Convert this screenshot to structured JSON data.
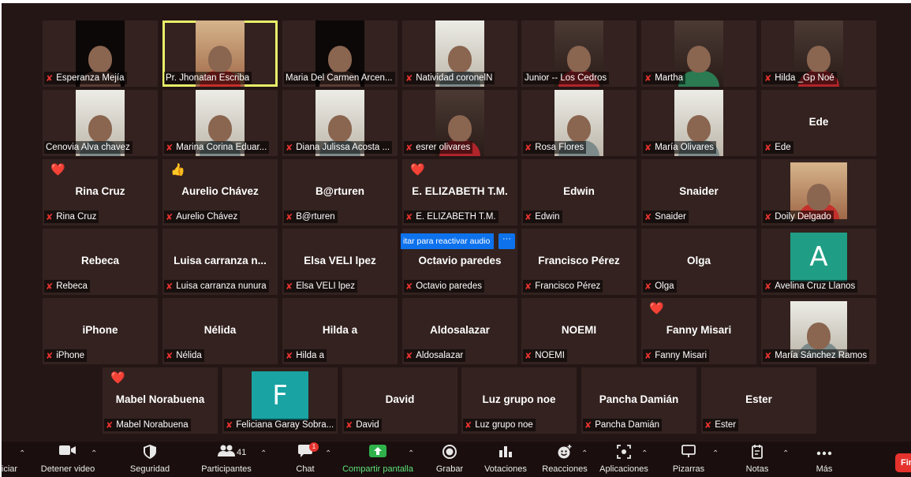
{
  "gallery": {
    "row1": [
      {
        "name": "Esperanza Mejía",
        "muted": true,
        "video": "dark"
      },
      {
        "name": "Pr. Jhonatan Escriba",
        "muted": false,
        "video": "warm",
        "active": true
      },
      {
        "name": "Maria Del Carmen Arcen...",
        "muted": false,
        "video": "dark"
      },
      {
        "name": "Natividad coronelN",
        "muted": true,
        "video": "light"
      },
      {
        "name": "Junior -- Los  Cedros",
        "muted": false,
        "video": "red"
      },
      {
        "name": "Martha",
        "muted": true,
        "video": "green"
      },
      {
        "name": "Hilda _Gp Noé",
        "muted": true,
        "video": "red"
      }
    ],
    "row2": [
      {
        "name": "Cenovia Alva chavez",
        "muted": false,
        "video": "light"
      },
      {
        "name": "Marina Corina Eduar...",
        "muted": true,
        "video": "light"
      },
      {
        "name": "Diana Julissa Acosta ...",
        "muted": true,
        "video": "light"
      },
      {
        "name": "esrer olivares",
        "muted": true,
        "video": "red"
      },
      {
        "name": "Rosa Flores",
        "muted": true,
        "video": "light"
      },
      {
        "name": "María Olivares",
        "muted": true,
        "video": "light"
      },
      {
        "name": "Ede",
        "muted": true,
        "center": "Ede"
      }
    ],
    "row3": [
      {
        "name": "Rina Cruz",
        "muted": true,
        "center": "Rina Cruz",
        "reaction": "❤️"
      },
      {
        "name": "Aurelio Chávez",
        "muted": true,
        "center": "Aurelio Chávez",
        "reaction": "👍"
      },
      {
        "name": "B@rturen",
        "muted": true,
        "center": "B@rturen"
      },
      {
        "name": "E. ELIZABETH T.M.",
        "muted": true,
        "center": "E. ELIZABETH T.M.",
        "reaction": "❤️"
      },
      {
        "name": "Edwin",
        "muted": true,
        "center": "Edwin"
      },
      {
        "name": "Snaider",
        "muted": true,
        "center": "Snaider"
      },
      {
        "name": "Doily Delgado",
        "muted": true,
        "video": "warm"
      }
    ],
    "row4": [
      {
        "name": "Rebeca",
        "muted": true,
        "center": "Rebeca"
      },
      {
        "name": "Luisa carranza nunura",
        "muted": true,
        "center": "Luisa carranza n..."
      },
      {
        "name": "Elsa VELI lpez",
        "muted": true,
        "center": "Elsa VELI lpez"
      },
      {
        "name": "Octavio paredes",
        "muted": true,
        "center": "Octavio paredes"
      },
      {
        "name": "Francisco Pérez",
        "muted": true,
        "center": "Francisco Pérez"
      },
      {
        "name": "Olga",
        "muted": true,
        "center": "Olga"
      },
      {
        "name": "Avelina Cruz Llanos",
        "muted": true,
        "avatar": "A",
        "avatar_color": "#1f9e85"
      }
    ],
    "row5": [
      {
        "name": "iPhone",
        "muted": true,
        "center": "iPhone"
      },
      {
        "name": "Nélida",
        "muted": true,
        "center": "Nélida"
      },
      {
        "name": "Hilda a",
        "muted": true,
        "center": "Hilda a"
      },
      {
        "name": "Aldosalazar",
        "muted": true,
        "center": "Aldosalazar"
      },
      {
        "name": "NOEMI",
        "muted": true,
        "center": "NOEMI"
      },
      {
        "name": "Fanny Misari",
        "muted": true,
        "center": "Fanny Misari",
        "reaction": "❤️"
      },
      {
        "name": "María Sánchez Ramos",
        "muted": true,
        "video": "light"
      }
    ],
    "row6": [
      {
        "name": "Mabel Norabuena",
        "muted": true,
        "center": "Mabel Norabuena",
        "reaction": "❤️"
      },
      {
        "name": "Feliciana Garay Sobra...",
        "muted": true,
        "avatar": "F",
        "avatar_color": "#1aa3a3"
      },
      {
        "name": "David",
        "muted": true,
        "center": "David"
      },
      {
        "name": "Luz grupo noe",
        "muted": true,
        "center": "Luz grupo noe"
      },
      {
        "name": "Pancha Damián",
        "muted": true,
        "center": "Pancha Damián"
      },
      {
        "name": "Ester",
        "muted": true,
        "center": "Ester"
      }
    ]
  },
  "unmute_tooltip": "itar para reactivar audio",
  "more_options": "···",
  "toolbar": {
    "audio_label": "iciar",
    "video_label": "Detener video",
    "security_label": "Seguridad",
    "participants_label": "Participantes",
    "participants_count": "41",
    "chat_label": "Chat",
    "chat_badge": "1",
    "share_label": "Compartir pantalla",
    "record_label": "Grabar",
    "polls_label": "Votaciones",
    "reactions_label": "Reacciones",
    "apps_label": "Aplicaciones",
    "whiteboards_label": "Pizarras",
    "notes_label": "Notas",
    "more_label": "Más",
    "end_label": "Fin"
  },
  "colors": {
    "background": "#251616",
    "tile": "#33221f",
    "active_speaker": "#e8f06a",
    "muted_icon": "#e5322d",
    "share_green": "#5ee07a",
    "tooltip_blue": "#0e72ed"
  }
}
